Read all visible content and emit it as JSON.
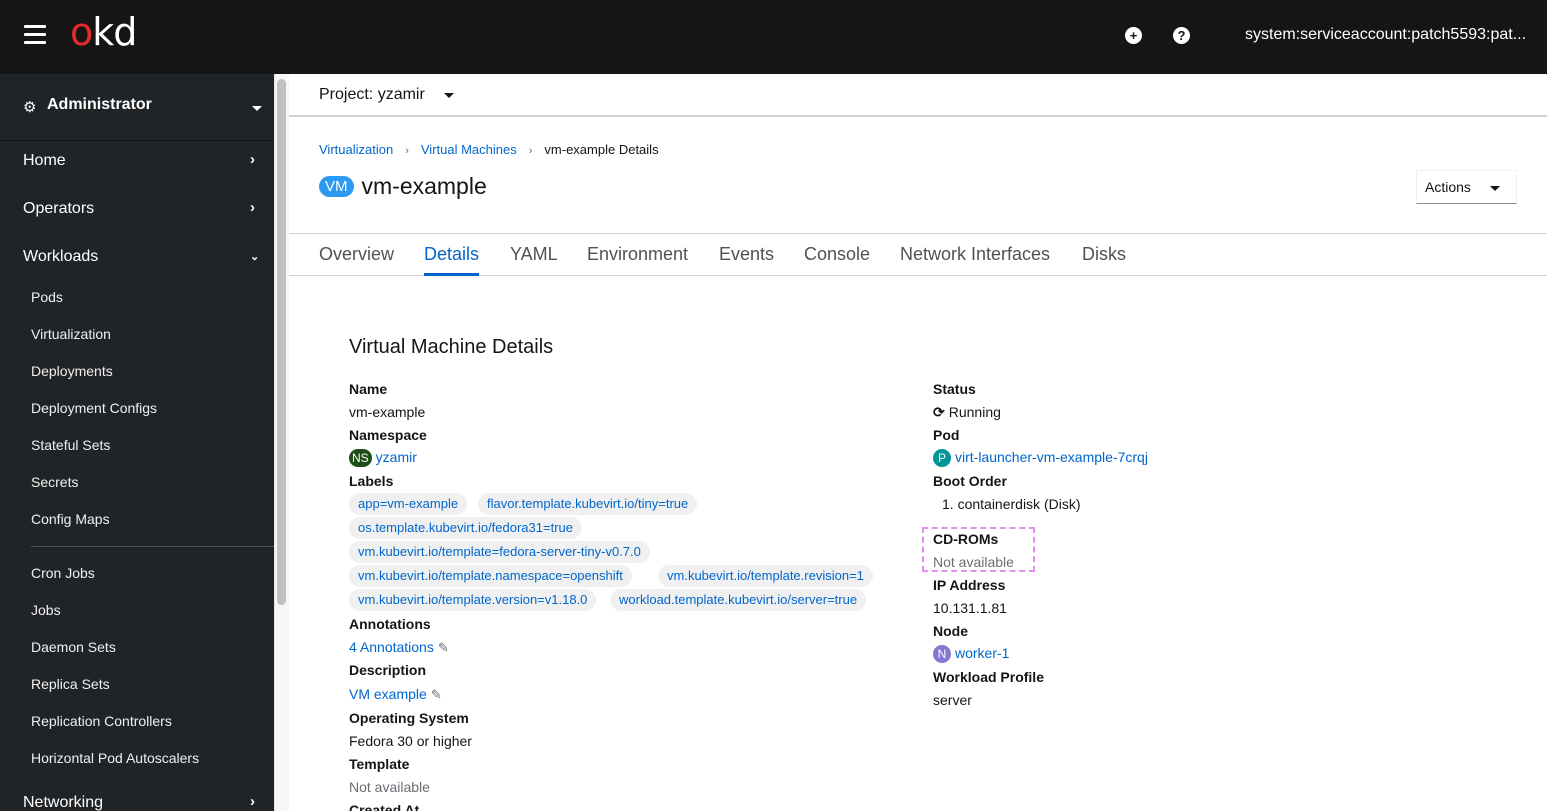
{
  "masthead": {
    "logo_o": "o",
    "logo_kd": "kd",
    "add_icon": "plus-circle-icon",
    "help_icon": "question-circle-icon",
    "user": "system:serviceaccount:patch5593:pat..."
  },
  "sidebar": {
    "perspective": "Administrator",
    "sections": [
      {
        "label": "Home",
        "expanded": false
      },
      {
        "label": "Operators",
        "expanded": false
      },
      {
        "label": "Workloads",
        "expanded": true
      },
      {
        "label": "Networking",
        "expanded": false
      }
    ],
    "workload_items": [
      "Pods",
      "Virtualization",
      "Deployments",
      "Deployment Configs",
      "Stateful Sets",
      "Secrets",
      "Config Maps"
    ],
    "workload_items_2": [
      "Cron Jobs",
      "Jobs",
      "Daemon Sets",
      "Replica Sets",
      "Replication Controllers",
      "Horizontal Pod Autoscalers"
    ]
  },
  "project": {
    "label": "Project: yzamir"
  },
  "breadcrumb": {
    "items": [
      "Virtualization",
      "Virtual Machines"
    ],
    "current": "vm-example Details"
  },
  "header": {
    "badge": "VM",
    "title": "vm-example",
    "actions_label": "Actions"
  },
  "tabs": [
    "Overview",
    "Details",
    "YAML",
    "Environment",
    "Events",
    "Console",
    "Network Interfaces",
    "Disks"
  ],
  "active_tab": "Details",
  "details": {
    "section_title": "Virtual Machine Details",
    "left": {
      "name_label": "Name",
      "name_value": "vm-example",
      "namespace_label": "Namespace",
      "namespace_badge": "NS",
      "namespace_value": "yzamir",
      "labels_label": "Labels",
      "labels": [
        "app=vm-example",
        "flavor.template.kubevirt.io/tiny=true",
        "os.template.kubevirt.io/fedora31=true",
        "vm.kubevirt.io/template=fedora-server-tiny-v0.7.0",
        "vm.kubevirt.io/template.namespace=openshift",
        "vm.kubevirt.io/template.revision=1",
        "vm.kubevirt.io/template.version=v1.18.0",
        "workload.template.kubevirt.io/server=true"
      ],
      "annotations_label": "Annotations",
      "annotations_value": "4 Annotations",
      "description_label": "Description",
      "description_value": "VM example",
      "os_label": "Operating System",
      "os_value": "Fedora 30 or higher",
      "template_label": "Template",
      "template_value": "Not available",
      "created_label": "Created At"
    },
    "right": {
      "status_label": "Status",
      "status_value": "Running",
      "pod_label": "Pod",
      "pod_badge": "P",
      "pod_value": "virt-launcher-vm-example-7crqj",
      "boot_label": "Boot Order",
      "boot_value": "1. containerdisk (Disk)",
      "cdrom_label": "CD-ROMs",
      "cdrom_value": "Not available",
      "ip_label": "IP Address",
      "ip_value": "10.131.1.81",
      "node_label": "Node",
      "node_badge": "N",
      "node_value": "worker-1",
      "profile_label": "Workload Profile",
      "profile_value": "server"
    }
  },
  "colors": {
    "link": "#0066cc",
    "vm_badge": "#2b9af3",
    "ns_badge": "#1e4f18",
    "pod_badge": "#009596",
    "node_badge": "#8476d1",
    "logo_red": "#e8282c"
  }
}
